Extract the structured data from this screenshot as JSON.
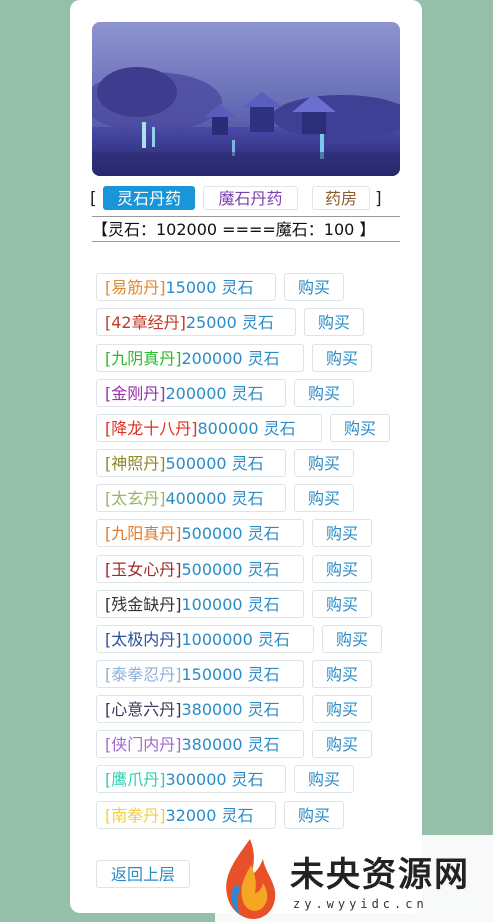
{
  "tabs": {
    "open_bracket": "[",
    "close_bracket": "]",
    "items": [
      {
        "label": "灵石丹药",
        "active": true
      },
      {
        "label": "魔石丹药",
        "active": false
      },
      {
        "label": "药房",
        "active": false
      }
    ]
  },
  "status": {
    "text": "【灵石：102000 ====魔石：100 】"
  },
  "shop": {
    "buy_label": "购买",
    "items": [
      {
        "name": "[易筋丹]",
        "price": "15000 灵石",
        "color": "#e08a2c"
      },
      {
        "name": "[42章经丹]",
        "price": "25000 灵石",
        "color": "#c0392b"
      },
      {
        "name": "[九阴真丹]",
        "price": "200000 灵石",
        "color": "#2eb82e"
      },
      {
        "name": "[金刚丹]",
        "price": "200000 灵石",
        "color": "#9b2fae"
      },
      {
        "name": "[降龙十八丹]",
        "price": "800000 灵石",
        "color": "#e03020"
      },
      {
        "name": "[神照丹]",
        "price": "500000 灵石",
        "color": "#8a8a2a"
      },
      {
        "name": "[太玄丹]",
        "price": "400000 灵石",
        "color": "#9ab56a"
      },
      {
        "name": "[九阳真丹]",
        "price": "500000 灵石",
        "color": "#e07a2a"
      },
      {
        "name": "[玉女心丹]",
        "price": "500000 灵石",
        "color": "#a02a2a"
      },
      {
        "name": "[残金缺丹]",
        "price": "100000 灵石",
        "color": "#333333"
      },
      {
        "name": "[太极内丹]",
        "price": "1000000 灵石",
        "color": "#2a4f9e"
      },
      {
        "name": "[泰拳忍丹]",
        "price": "150000 灵石",
        "color": "#8fb0d8"
      },
      {
        "name": "[心意六丹]",
        "price": "380000 灵石",
        "color": "#3a3a5a"
      },
      {
        "name": "[侠门内丹]",
        "price": "380000 灵石",
        "color": "#a06ad0"
      },
      {
        "name": "[鹰爪丹]",
        "price": "300000 灵石",
        "color": "#2ad0b0"
      },
      {
        "name": "[南拳丹]",
        "price": "32000 灵石",
        "color": "#f0d040"
      }
    ]
  },
  "footer": {
    "back_label": "返回上层"
  },
  "watermark": {
    "title": "未央资源网",
    "url": "zy.wyyidc.cn"
  }
}
